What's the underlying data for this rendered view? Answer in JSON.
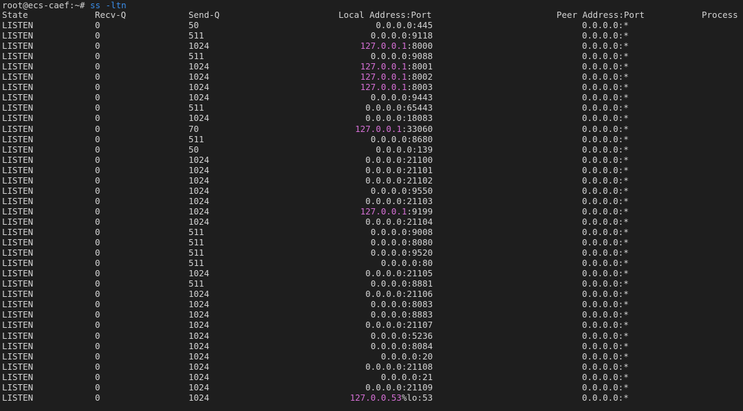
{
  "prompt": {
    "user_host": "root@ecs-caef:~# ",
    "command": "ss -ltn"
  },
  "headers": {
    "state": "State",
    "recv_q": "Recv-Q",
    "send_q": "Send-Q",
    "local": "Local Address:Port",
    "peer": "Peer Address:Port",
    "process": "Process"
  },
  "colors": {
    "background": "#1e1e1e",
    "text": "#d4d4d4",
    "command": "#3b8eea",
    "loopback_highlight": "#d670d6"
  },
  "rows": [
    {
      "state": "LISTEN",
      "recv": "0",
      "send": "50",
      "hl": "",
      "rest": "0.0.0.0:445",
      "peer": "0.0.0.0:*"
    },
    {
      "state": "LISTEN",
      "recv": "0",
      "send": "511",
      "hl": "",
      "rest": "0.0.0.0:9118",
      "peer": "0.0.0.0:*"
    },
    {
      "state": "LISTEN",
      "recv": "0",
      "send": "1024",
      "hl": "127.0.0.1",
      "rest": ":8000",
      "peer": "0.0.0.0:*"
    },
    {
      "state": "LISTEN",
      "recv": "0",
      "send": "511",
      "hl": "",
      "rest": "0.0.0.0:9088",
      "peer": "0.0.0.0:*"
    },
    {
      "state": "LISTEN",
      "recv": "0",
      "send": "1024",
      "hl": "127.0.0.1",
      "rest": ":8001",
      "peer": "0.0.0.0:*"
    },
    {
      "state": "LISTEN",
      "recv": "0",
      "send": "1024",
      "hl": "127.0.0.1",
      "rest": ":8002",
      "peer": "0.0.0.0:*"
    },
    {
      "state": "LISTEN",
      "recv": "0",
      "send": "1024",
      "hl": "127.0.0.1",
      "rest": ":8003",
      "peer": "0.0.0.0:*"
    },
    {
      "state": "LISTEN",
      "recv": "0",
      "send": "1024",
      "hl": "",
      "rest": "0.0.0.0:9443",
      "peer": "0.0.0.0:*"
    },
    {
      "state": "LISTEN",
      "recv": "0",
      "send": "511",
      "hl": "",
      "rest": "0.0.0.0:65443",
      "peer": "0.0.0.0:*"
    },
    {
      "state": "LISTEN",
      "recv": "0",
      "send": "1024",
      "hl": "",
      "rest": "0.0.0.0:18083",
      "peer": "0.0.0.0:*"
    },
    {
      "state": "LISTEN",
      "recv": "0",
      "send": "70",
      "hl": "127.0.0.1",
      "rest": ":33060",
      "peer": "0.0.0.0:*"
    },
    {
      "state": "LISTEN",
      "recv": "0",
      "send": "511",
      "hl": "",
      "rest": "0.0.0.0:8680",
      "peer": "0.0.0.0:*"
    },
    {
      "state": "LISTEN",
      "recv": "0",
      "send": "50",
      "hl": "",
      "rest": "0.0.0.0:139",
      "peer": "0.0.0.0:*"
    },
    {
      "state": "LISTEN",
      "recv": "0",
      "send": "1024",
      "hl": "",
      "rest": "0.0.0.0:21100",
      "peer": "0.0.0.0:*"
    },
    {
      "state": "LISTEN",
      "recv": "0",
      "send": "1024",
      "hl": "",
      "rest": "0.0.0.0:21101",
      "peer": "0.0.0.0:*"
    },
    {
      "state": "LISTEN",
      "recv": "0",
      "send": "1024",
      "hl": "",
      "rest": "0.0.0.0:21102",
      "peer": "0.0.0.0:*"
    },
    {
      "state": "LISTEN",
      "recv": "0",
      "send": "1024",
      "hl": "",
      "rest": "0.0.0.0:9550",
      "peer": "0.0.0.0:*"
    },
    {
      "state": "LISTEN",
      "recv": "0",
      "send": "1024",
      "hl": "",
      "rest": "0.0.0.0:21103",
      "peer": "0.0.0.0:*"
    },
    {
      "state": "LISTEN",
      "recv": "0",
      "send": "1024",
      "hl": "127.0.0.1",
      "rest": ":9199",
      "peer": "0.0.0.0:*"
    },
    {
      "state": "LISTEN",
      "recv": "0",
      "send": "1024",
      "hl": "",
      "rest": "0.0.0.0:21104",
      "peer": "0.0.0.0:*"
    },
    {
      "state": "LISTEN",
      "recv": "0",
      "send": "511",
      "hl": "",
      "rest": "0.0.0.0:9008",
      "peer": "0.0.0.0:*"
    },
    {
      "state": "LISTEN",
      "recv": "0",
      "send": "511",
      "hl": "",
      "rest": "0.0.0.0:8080",
      "peer": "0.0.0.0:*"
    },
    {
      "state": "LISTEN",
      "recv": "0",
      "send": "511",
      "hl": "",
      "rest": "0.0.0.0:9520",
      "peer": "0.0.0.0:*"
    },
    {
      "state": "LISTEN",
      "recv": "0",
      "send": "511",
      "hl": "",
      "rest": "0.0.0.0:80",
      "peer": "0.0.0.0:*"
    },
    {
      "state": "LISTEN",
      "recv": "0",
      "send": "1024",
      "hl": "",
      "rest": "0.0.0.0:21105",
      "peer": "0.0.0.0:*"
    },
    {
      "state": "LISTEN",
      "recv": "0",
      "send": "511",
      "hl": "",
      "rest": "0.0.0.0:8881",
      "peer": "0.0.0.0:*"
    },
    {
      "state": "LISTEN",
      "recv": "0",
      "send": "1024",
      "hl": "",
      "rest": "0.0.0.0:21106",
      "peer": "0.0.0.0:*"
    },
    {
      "state": "LISTEN",
      "recv": "0",
      "send": "1024",
      "hl": "",
      "rest": "0.0.0.0:8083",
      "peer": "0.0.0.0:*"
    },
    {
      "state": "LISTEN",
      "recv": "0",
      "send": "1024",
      "hl": "",
      "rest": "0.0.0.0:8883",
      "peer": "0.0.0.0:*"
    },
    {
      "state": "LISTEN",
      "recv": "0",
      "send": "1024",
      "hl": "",
      "rest": "0.0.0.0:21107",
      "peer": "0.0.0.0:*"
    },
    {
      "state": "LISTEN",
      "recv": "0",
      "send": "1024",
      "hl": "",
      "rest": "0.0.0.0:5236",
      "peer": "0.0.0.0:*"
    },
    {
      "state": "LISTEN",
      "recv": "0",
      "send": "1024",
      "hl": "",
      "rest": "0.0.0.0:8084",
      "peer": "0.0.0.0:*"
    },
    {
      "state": "LISTEN",
      "recv": "0",
      "send": "1024",
      "hl": "",
      "rest": "0.0.0.0:20",
      "peer": "0.0.0.0:*"
    },
    {
      "state": "LISTEN",
      "recv": "0",
      "send": "1024",
      "hl": "",
      "rest": "0.0.0.0:21108",
      "peer": "0.0.0.0:*"
    },
    {
      "state": "LISTEN",
      "recv": "0",
      "send": "1024",
      "hl": "",
      "rest": "0.0.0.0:21",
      "peer": "0.0.0.0:*"
    },
    {
      "state": "LISTEN",
      "recv": "0",
      "send": "1024",
      "hl": "",
      "rest": "0.0.0.0:21109",
      "peer": "0.0.0.0:*"
    },
    {
      "state": "LISTEN",
      "recv": "0",
      "send": "1024",
      "hl": "127.0.0.53",
      "rest": "%lo:53",
      "peer": "0.0.0.0:*"
    }
  ]
}
